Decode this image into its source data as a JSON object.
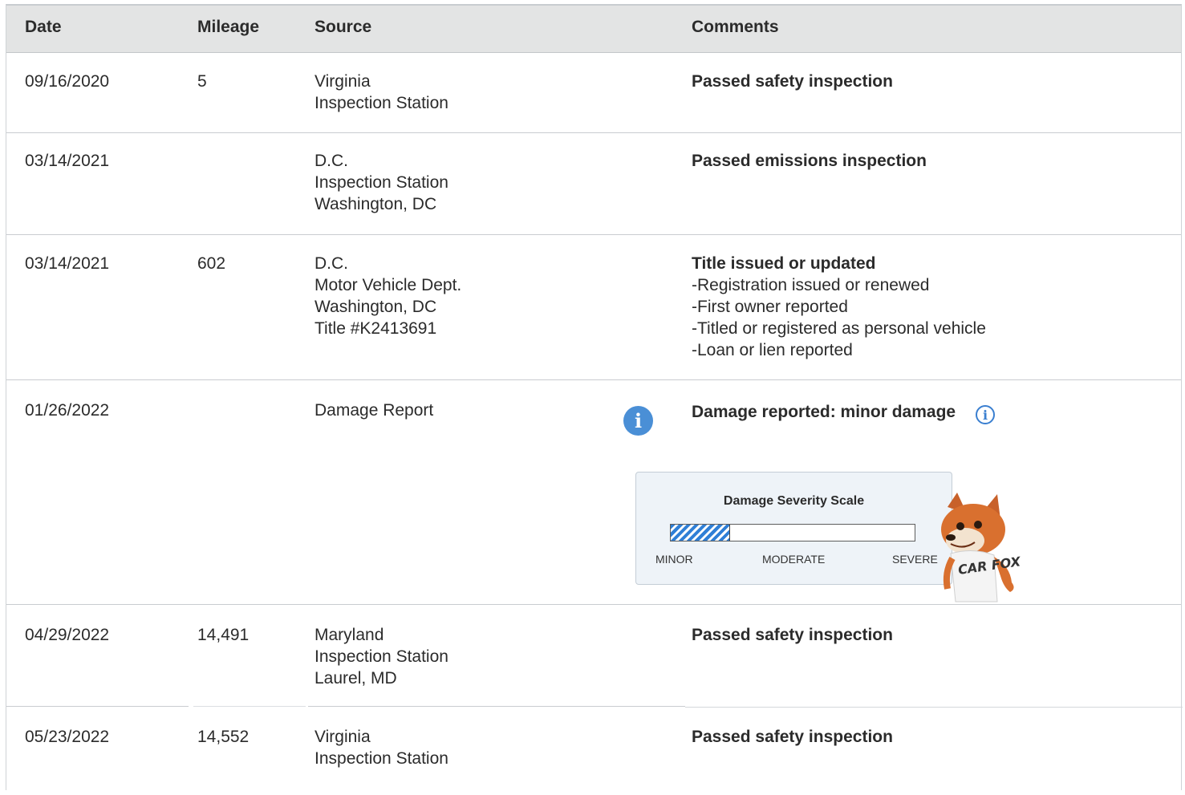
{
  "columns": {
    "date": "Date",
    "mileage": "Mileage",
    "source": "Source",
    "comments": "Comments"
  },
  "rows": [
    {
      "date": "09/16/2020",
      "mileage": "5",
      "source": [
        "Virginia",
        "Inspection Station"
      ],
      "comment_title": "Passed safety inspection",
      "comment_items": []
    },
    {
      "date": "03/14/2021",
      "mileage": "",
      "source": [
        "D.C.",
        "Inspection Station",
        "Washington, DC"
      ],
      "comment_title": "Passed emissions inspection",
      "comment_items": []
    },
    {
      "date": "03/14/2021",
      "mileage": "602",
      "source": [
        "D.C.",
        "Motor Vehicle Dept.",
        "Washington, DC",
        "Title #K2413691"
      ],
      "comment_title": "Title issued or updated",
      "comment_items": [
        "Registration issued or renewed",
        "First owner reported",
        "Titled or registered as personal vehicle",
        "Loan or lien reported"
      ]
    },
    {
      "date": "01/26/2022",
      "mileage": "",
      "source": [
        "Damage Report"
      ],
      "comment_title": "Damage reported: minor damage",
      "comment_items": []
    },
    {
      "date": "04/29/2022",
      "mileage": "14,491",
      "source": [
        "Maryland",
        "Inspection Station",
        "Laurel, MD"
      ],
      "comment_title": "Passed safety inspection",
      "comment_items": []
    },
    {
      "date": "05/23/2022",
      "mileage": "14,552",
      "source": [
        "Virginia",
        "Inspection Station"
      ],
      "comment_title": "Passed safety inspection",
      "comment_items": []
    }
  ],
  "damage_scale": {
    "title": "Damage Severity Scale",
    "labels": [
      "MINOR",
      "MODERATE",
      "SEVERE"
    ],
    "level_fraction": 0.24,
    "fill_color": "#2f7fd6"
  },
  "info_icon_glyph": "i",
  "mascot_shirt_text": "CAR FOX",
  "accent_color": "#4a8fd6"
}
